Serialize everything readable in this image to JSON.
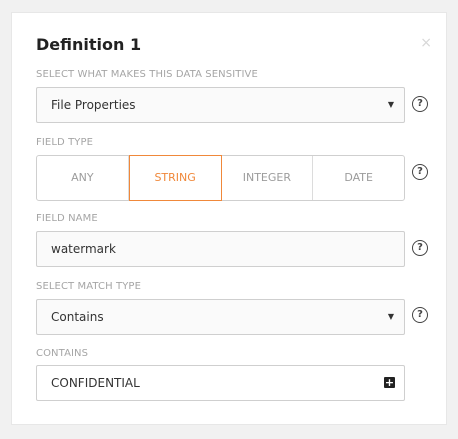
{
  "dialog": {
    "title": "Definition 1",
    "close_glyph": "×"
  },
  "sensitive": {
    "label": "SELECT WHAT MAKES THIS DATA SENSITIVE",
    "value": "File Properties",
    "caret": "▼",
    "help": "?"
  },
  "field_type": {
    "label": "FIELD TYPE",
    "options": [
      "ANY",
      "STRING",
      "INTEGER",
      "DATE"
    ],
    "selected": "STRING",
    "help": "?"
  },
  "field_name": {
    "label": "FIELD NAME",
    "value": "watermark",
    "help": "?"
  },
  "match_type": {
    "label": "SELECT MATCH TYPE",
    "value": "Contains",
    "caret": "▼",
    "help": "?"
  },
  "contains": {
    "label": "CONTAINS",
    "value": "CONFIDENTIAL",
    "add_glyph": "+"
  },
  "colors": {
    "accent": "#f0883a",
    "background": "#f1f1f1"
  }
}
